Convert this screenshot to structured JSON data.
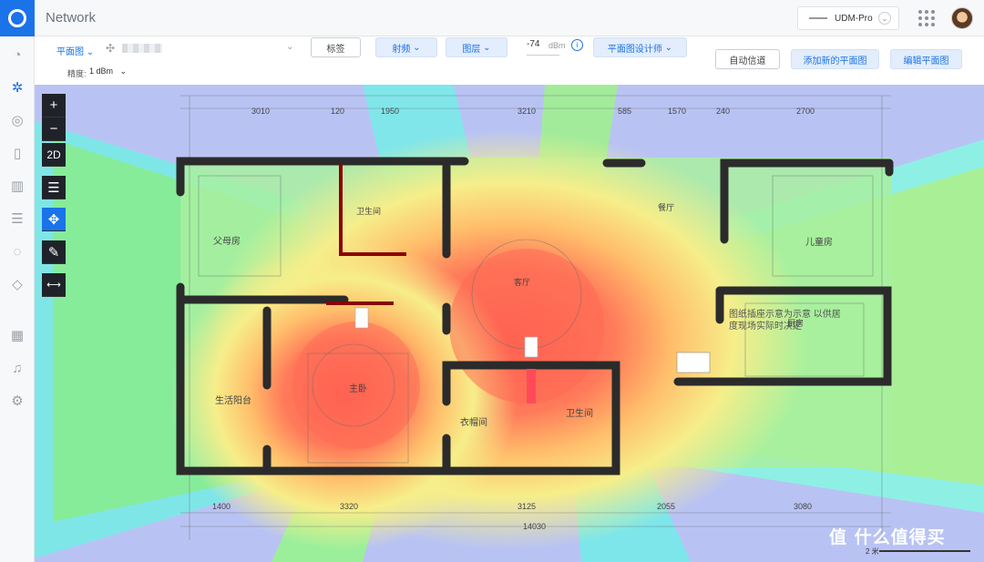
{
  "app": {
    "title": "Network",
    "device": "UDM-Pro"
  },
  "toolbar": {
    "view_select": "平面图",
    "tags_label": "标签",
    "radio_label": "射频",
    "layers_label": "图层",
    "signal_value": "-74",
    "signal_unit": "dBm",
    "designer_label": "平面图设计师",
    "precision_label": "精度:",
    "precision_value": "1 dBm",
    "auto_channel": "自动信道",
    "add_floorplan": "添加新的平面图",
    "edit_floorplan": "编辑平面图"
  },
  "plan_tools": {
    "view_mode": "2D"
  },
  "rooms": {
    "parents_room": "父母房",
    "bathroom1": "卫生间",
    "dining": "餐厅",
    "living": "客厅",
    "kids_room": "儿童房",
    "kitchen": "厨房",
    "master": "主卧",
    "balcony": "生活阳台",
    "closet": "衣帽间",
    "bathroom2": "卫生间",
    "note": "图纸插座示意为示意 以供居度现场实际时决定"
  },
  "dimensions": {
    "top": [
      "3010",
      "120",
      "1950",
      "3210",
      "585",
      "1570",
      "240",
      "2700"
    ],
    "bottom": [
      "1400",
      "3320",
      "3125",
      "2055",
      "3080"
    ],
    "total": "14030"
  },
  "scale_label": "2 米",
  "watermark": "值 什么值得买",
  "colors": {
    "accent": "#1a73e8",
    "wall": "#2b2b2b"
  }
}
